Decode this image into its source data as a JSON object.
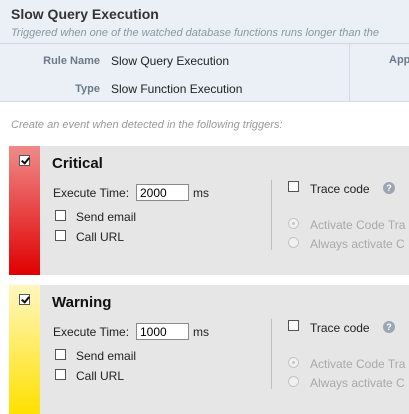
{
  "header": {
    "title": "Slow Query Execution",
    "subtitle": "Triggered when one of the watched database functions runs longer than the",
    "rule_name_label": "Rule Name",
    "rule_name_value": "Slow Query Execution",
    "type_label": "Type",
    "type_value": "Slow Function Execution",
    "app_label": "App"
  },
  "instructions": "Create an event when detected in the following triggers:",
  "triggers": [
    {
      "name": "Critical",
      "enabled": true,
      "color": "#e00000",
      "execute_time_label": "Execute Time:",
      "execute_time_value": "2000",
      "unit": "ms",
      "send_email_label": "Send email",
      "send_email_checked": false,
      "call_url_label": "Call URL",
      "call_url_checked": false,
      "trace_code_label": "Trace code",
      "trace_code_checked": false,
      "activate_code_trace_label": "Activate Code Tra",
      "always_activate_label": "Always activate C",
      "help_icon": "question-help-icon"
    },
    {
      "name": "Warning",
      "enabled": true,
      "color": "#ffe000",
      "execute_time_label": "Execute Time:",
      "execute_time_value": "1000",
      "unit": "ms",
      "send_email_label": "Send email",
      "send_email_checked": false,
      "call_url_label": "Call URL",
      "call_url_checked": false,
      "trace_code_label": "Trace code",
      "trace_code_checked": false,
      "activate_code_trace_label": "Activate Code Tra",
      "always_activate_label": "Always activate C",
      "help_icon": "question-help-icon"
    }
  ]
}
